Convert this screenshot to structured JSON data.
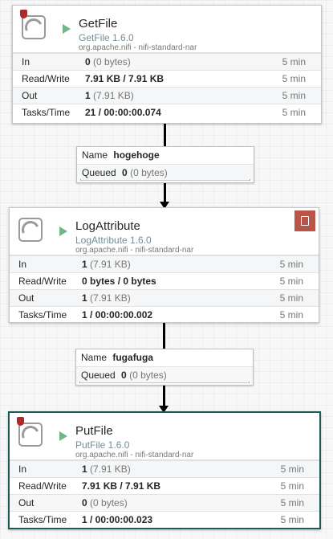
{
  "processors": [
    {
      "name": "GetFile",
      "type": "GetFile 1.6.0",
      "bundle": "org.apache.nifi - nifi-standard-nar",
      "restricted": true,
      "has_comment": false,
      "in_count": "0",
      "in_detail": "(0 bytes)",
      "rw": "7.91 KB / 7.91 KB",
      "out_count": "1",
      "out_detail": "(7.91 KB)",
      "tasks": "21 / 00:00:00.074",
      "period": "5 min"
    },
    {
      "name": "LogAttribute",
      "type": "LogAttribute 1.6.0",
      "bundle": "org.apache.nifi - nifi-standard-nar",
      "restricted": false,
      "has_comment": true,
      "in_count": "1",
      "in_detail": "(7.91 KB)",
      "rw": "0 bytes / 0 bytes",
      "out_count": "1",
      "out_detail": "(7.91 KB)",
      "tasks": "1 / 00:00:00.002",
      "period": "5 min"
    },
    {
      "name": "PutFile",
      "type": "PutFile 1.6.0",
      "bundle": "org.apache.nifi - nifi-standard-nar",
      "restricted": true,
      "has_comment": false,
      "in_count": "1",
      "in_detail": "(7.91 KB)",
      "rw": "7.91 KB / 7.91 KB",
      "out_count": "0",
      "out_detail": "(0 bytes)",
      "tasks": "1 / 00:00:00.023",
      "period": "5 min"
    }
  ],
  "labels": {
    "in": "In",
    "rw": "Read/Write",
    "out": "Out",
    "tasks": "Tasks/Time",
    "conn_name": "Name",
    "conn_queued": "Queued"
  },
  "connections": [
    {
      "name": "hogehoge",
      "queued_count": "0",
      "queued_detail": "(0 bytes)"
    },
    {
      "name": "fugafuga",
      "queued_count": "0",
      "queued_detail": "(0 bytes)"
    }
  ]
}
